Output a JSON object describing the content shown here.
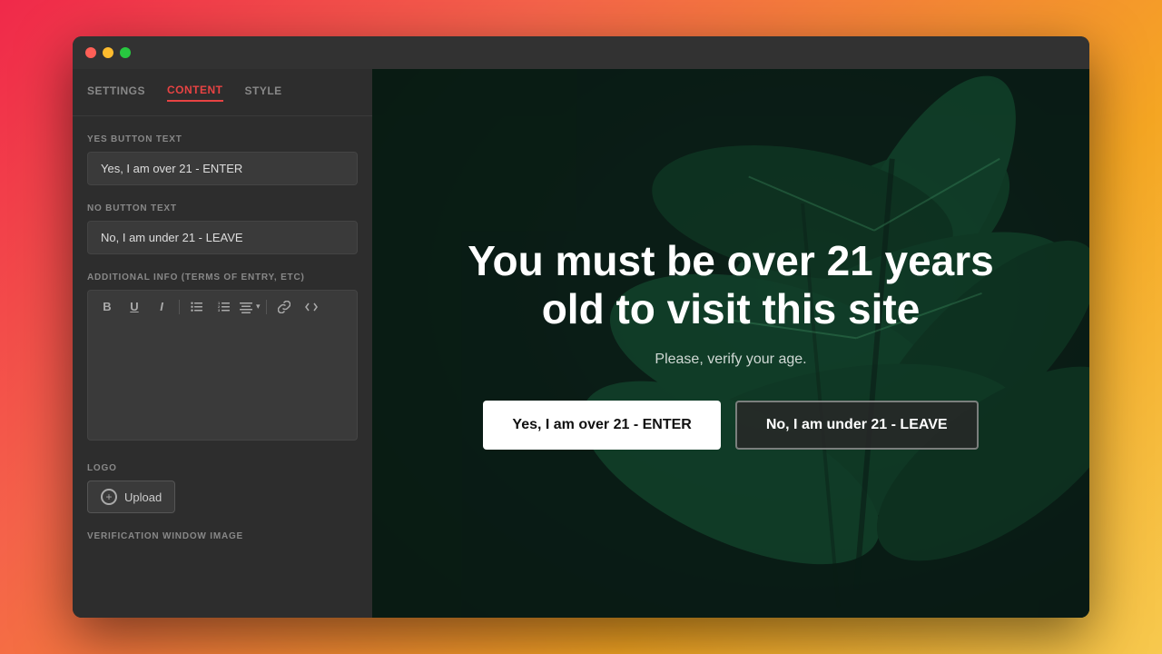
{
  "window": {
    "dots": [
      "red",
      "yellow",
      "green"
    ]
  },
  "tabs": [
    {
      "id": "settings",
      "label": "SETTINGS",
      "active": false
    },
    {
      "id": "content",
      "label": "CONTENT",
      "active": true
    },
    {
      "id": "style",
      "label": "STYLE",
      "active": false
    }
  ],
  "panel": {
    "yes_button_label": "YES BUTTON TEXT",
    "yes_button_value": "Yes, I am over 21 - ENTER",
    "no_button_label": "NO BUTTON TEXT",
    "no_button_value": "No, I am under 21 - LEAVE",
    "additional_info_label": "ADDITIONAL INFO (TERMS OF ENTRY, ETC)",
    "logo_label": "LOGO",
    "upload_label": "Upload",
    "verification_window_label": "VERIFICATION WINDOW IMAGE"
  },
  "toolbar": {
    "bold": "B",
    "underline": "U",
    "italic": "I",
    "unordered_list": "≡",
    "ordered_list": "≡",
    "align": "≡",
    "link": "🔗",
    "code": "<>"
  },
  "preview": {
    "title": "You must be over 21 years old to visit this site",
    "subtitle": "Please, verify your age.",
    "yes_button": "Yes, I am over 21 - ENTER",
    "no_button": "No, I am under 21 - LEAVE"
  }
}
